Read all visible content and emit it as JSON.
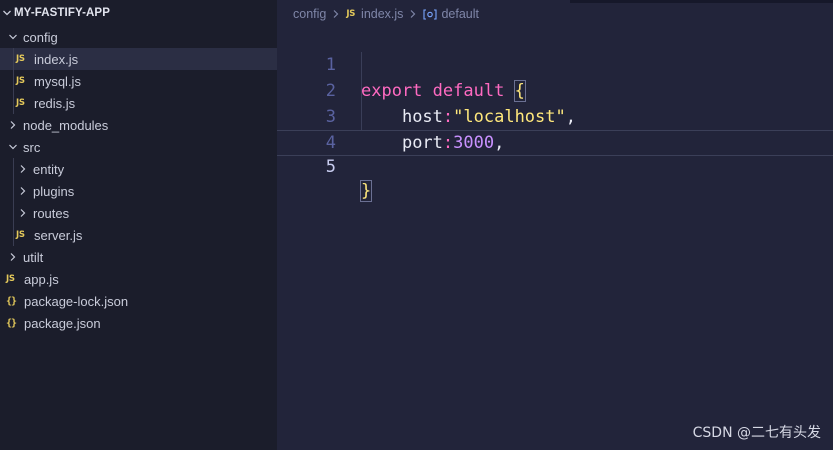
{
  "explorer": {
    "project_title": "MY-FASTIFY-APP",
    "items": [
      {
        "label": "config",
        "kind": "folder",
        "expanded": true,
        "depth": 0
      },
      {
        "label": "index.js",
        "kind": "js",
        "depth": 1,
        "selected": true
      },
      {
        "label": "mysql.js",
        "kind": "js",
        "depth": 1
      },
      {
        "label": "redis.js",
        "kind": "js",
        "depth": 1
      },
      {
        "label": "node_modules",
        "kind": "folder",
        "expanded": false,
        "depth": 0
      },
      {
        "label": "src",
        "kind": "folder",
        "expanded": true,
        "depth": 0
      },
      {
        "label": "entity",
        "kind": "folder",
        "expanded": false,
        "depth": 1
      },
      {
        "label": "plugins",
        "kind": "folder",
        "expanded": false,
        "depth": 1
      },
      {
        "label": "routes",
        "kind": "folder",
        "expanded": false,
        "depth": 1
      },
      {
        "label": "server.js",
        "kind": "js",
        "depth": 1
      },
      {
        "label": "utilt",
        "kind": "folder",
        "expanded": false,
        "depth": 0
      },
      {
        "label": "app.js",
        "kind": "js",
        "depth": 0
      },
      {
        "label": "package-lock.json",
        "kind": "json",
        "depth": 0
      },
      {
        "label": "package.json",
        "kind": "json",
        "depth": 0
      }
    ],
    "js_icon_text": "JS",
    "json_icon_text": "{}"
  },
  "breadcrumb": {
    "folder": "config",
    "file": "index.js",
    "symbol": "default"
  },
  "editor": {
    "line_numbers": [
      "1",
      "2",
      "3",
      "4",
      "5"
    ],
    "active_line": 5,
    "code": {
      "l1_kw1": "export",
      "l1_kw2": "default",
      "l1_brace": "{",
      "l2_prop": "host",
      "l2_colon": ":",
      "l2_str": "\"localhost\"",
      "l2_comma": ",",
      "l3_prop": "port",
      "l3_colon": ":",
      "l3_num": "3000",
      "l3_comma": ",",
      "l5_brace": "}"
    }
  },
  "watermark": "CSDN @二七有头发",
  "colors": {
    "keyword": "#ff6ac1",
    "string": "#ffe87c",
    "number": "#c991ff",
    "icon_js": "#e4c95b",
    "sidebar_bg": "#1b1d2b",
    "editor_bg": "#22243a"
  }
}
